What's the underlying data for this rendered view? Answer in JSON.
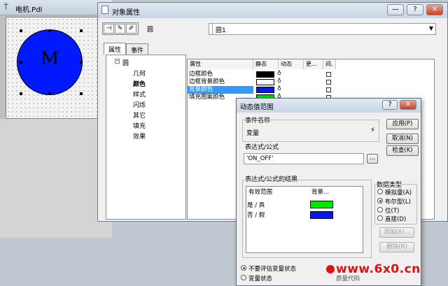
{
  "pdl_window": {
    "title": "电机.Pdl",
    "motor_label": "M"
  },
  "object_properties": {
    "title": "对象属性",
    "minimize": "—",
    "help": "?",
    "close": "✕",
    "object_type": "圆",
    "object_name": "圆1",
    "tabs": [
      "属性",
      "事件"
    ],
    "tree": {
      "root": "圆",
      "children": [
        "几何",
        "颜色",
        "样式",
        "闪烁",
        "其它",
        "填充",
        "效果"
      ],
      "selected": "颜色"
    },
    "columns": [
      "属性",
      "静态",
      "动态",
      "更...",
      "间."
    ],
    "rows": [
      {
        "name": "边框颜色",
        "color": "#000000",
        "selected": false
      },
      {
        "name": "边框背景颜色",
        "color": "#ffffff",
        "selected": false
      },
      {
        "name": "背景颜色",
        "color": "#0019ff",
        "selected": true
      },
      {
        "name": "填充图案颜色",
        "color": "#00d800",
        "selected": false
      }
    ]
  },
  "dynamic_dialog": {
    "title": "动态值范围",
    "help": "?",
    "close": "✕",
    "event_name_label": "事件名称",
    "event_name_value": "变量",
    "expression_label": "表达式/公式",
    "expression_value": "'ON_OFF'",
    "browse": "...",
    "result_label": "表达式/公式的结果",
    "table_headers": [
      "有效范围",
      "背景..."
    ],
    "table_rows": [
      {
        "range": "是 / 真",
        "color": "#00e600"
      },
      {
        "range": "否 / 假",
        "color": "#0019ff"
      }
    ],
    "buttons": {
      "apply": "应用(P)",
      "cancel": "取消(N)",
      "check": "检查(K)",
      "add": "添加(A)...",
      "delete": "删除(R)"
    },
    "data_type_label": "数据类型",
    "data_types": [
      "模拟量(A)",
      "布尔型(L)",
      "位(T)",
      "直接(D)"
    ],
    "data_type_selected": "布尔型(L)",
    "eval_options": [
      "不要评估变量状态",
      "变量状态"
    ],
    "eval_selected": "不要评估变量状态",
    "partial_text": "质量代码"
  },
  "watermark": "www.6x0.cn"
}
